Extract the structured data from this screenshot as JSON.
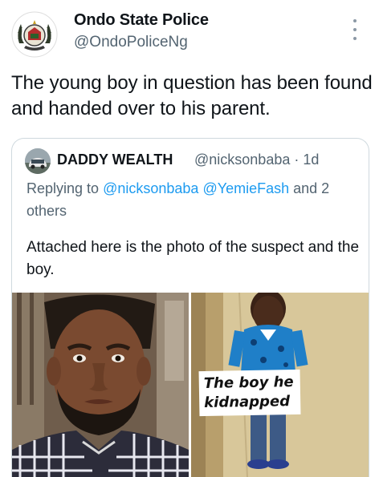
{
  "tweet": {
    "author_name": "Ondo State Police",
    "author_handle": "@OndoPoliceNg",
    "text": "The young boy in question has been found and handed over to his parent.",
    "more_icon": "more-vertical-icon"
  },
  "quoted_tweet": {
    "author_name": "DADDY WEALTH",
    "author_handle": "@nicksonbaba",
    "separator": "·",
    "time": "1d",
    "replying_prefix": "Replying to",
    "replying_handles": [
      "@nicksonbaba",
      "@YemieFash"
    ],
    "replying_suffix": "and 2 others",
    "text": "Attached here is the photo of the suspect and the boy.",
    "image_caption": "The boy he kidnapped"
  },
  "colors": {
    "link": "#1d9bf0",
    "secondary_text": "#536471",
    "border": "#cfd9de"
  }
}
